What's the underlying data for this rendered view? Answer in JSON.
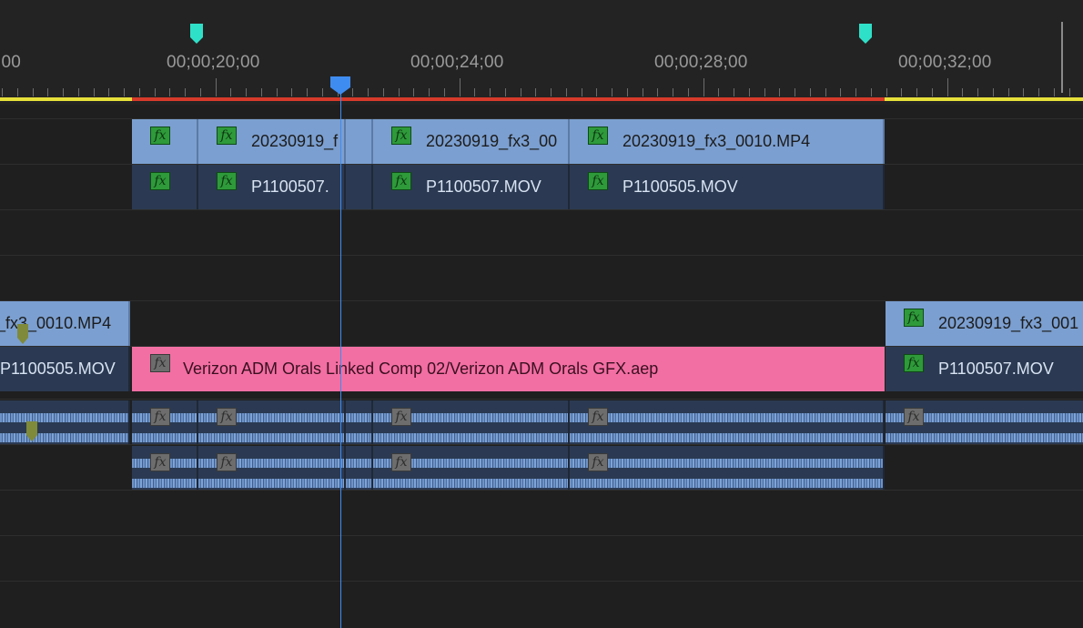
{
  "ruler": {
    "timecodes": [
      ":00",
      "00;00;20;00",
      "00;00;24;00",
      "00;00;28;00",
      "00;00;32;00"
    ]
  },
  "tracks": {
    "v3": [
      {
        "name": ""
      },
      {
        "name": "20230919_f"
      },
      {
        "name": ""
      },
      {
        "name": "20230919_fx3_00"
      },
      {
        "name": "20230919_fx3_0010.MP4"
      }
    ],
    "v2": [
      {
        "name": ""
      },
      {
        "name": "P1100507."
      },
      {
        "name": ""
      },
      {
        "name": "P1100507.MOV"
      },
      {
        "name": "P1100505.MOV"
      }
    ],
    "v1_top": [
      {
        "name": "_fx3_0010.MP4"
      },
      {
        "name": "20230919_fx3_001"
      }
    ],
    "v1_bot": [
      {
        "name": "P1100505.MOV"
      },
      {
        "name": "Verizon ADM Orals Linked Comp 02/Verizon ADM Orals GFX.aep"
      },
      {
        "name": "P1100507.MOV"
      }
    ]
  },
  "icons": {
    "fx": "fx",
    "marker": "marker-icon",
    "playhead": "playhead-icon"
  },
  "colors": {
    "background": "#1f1f1f",
    "video_clip": "#7b9fd0",
    "audio_clip": "#2b3a52",
    "graphics_clip": "#f26fa3",
    "work_area_red": "#d63a2a",
    "work_area_yellow": "#e6e03a",
    "marker": "#2fe0c8",
    "playhead": "#3f8cf0"
  }
}
